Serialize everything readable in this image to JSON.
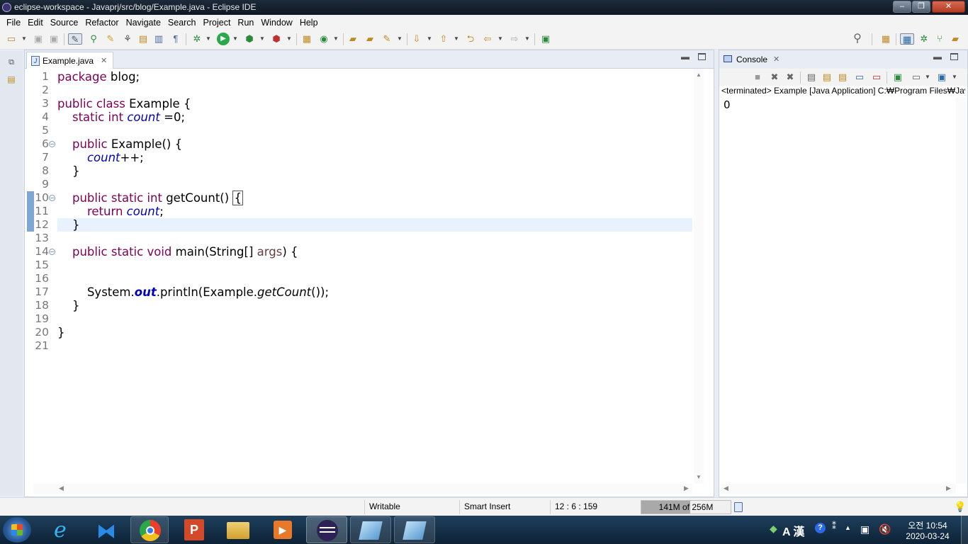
{
  "window": {
    "title": "eclipse-workspace - Javaprj/src/blog/Example.java - Eclipse IDE"
  },
  "menu": [
    "File",
    "Edit",
    "Source",
    "Refactor",
    "Navigate",
    "Search",
    "Project",
    "Run",
    "Window",
    "Help"
  ],
  "editor": {
    "tab": "Example.java",
    "lines": [
      {
        "n": "1",
        "segs": [
          {
            "t": "package",
            "c": "kw"
          },
          {
            "t": " blog;"
          }
        ]
      },
      {
        "n": "2",
        "segs": []
      },
      {
        "n": "3",
        "segs": [
          {
            "t": "public",
            "c": "kw"
          },
          {
            "t": " "
          },
          {
            "t": "class",
            "c": "kw"
          },
          {
            "t": " Example {"
          }
        ]
      },
      {
        "n": "4",
        "segs": [
          {
            "t": "    "
          },
          {
            "t": "static",
            "c": "kw"
          },
          {
            "t": " "
          },
          {
            "t": "int",
            "c": "kw"
          },
          {
            "t": " "
          },
          {
            "t": "count",
            "c": "fld"
          },
          {
            "t": " =0;"
          }
        ]
      },
      {
        "n": "5",
        "segs": []
      },
      {
        "n": "6",
        "fold": true,
        "segs": [
          {
            "t": "    "
          },
          {
            "t": "public",
            "c": "kw"
          },
          {
            "t": " Example() {"
          }
        ]
      },
      {
        "n": "7",
        "segs": [
          {
            "t": "        "
          },
          {
            "t": "count",
            "c": "fld"
          },
          {
            "t": "++;"
          }
        ]
      },
      {
        "n": "8",
        "segs": [
          {
            "t": "    }"
          }
        ]
      },
      {
        "n": "9",
        "segs": []
      },
      {
        "n": "10",
        "fold": true,
        "mark": true,
        "segs": [
          {
            "t": "    "
          },
          {
            "t": "public",
            "c": "kw"
          },
          {
            "t": " "
          },
          {
            "t": "static",
            "c": "kw"
          },
          {
            "t": " "
          },
          {
            "t": "int",
            "c": "kw"
          },
          {
            "t": " getCount() "
          },
          {
            "t": "{",
            "c": "brace"
          }
        ]
      },
      {
        "n": "11",
        "mark": true,
        "segs": [
          {
            "t": "        "
          },
          {
            "t": "return",
            "c": "kw"
          },
          {
            "t": " "
          },
          {
            "t": "count",
            "c": "fld"
          },
          {
            "t": ";"
          }
        ]
      },
      {
        "n": "12",
        "mark": true,
        "current": true,
        "segs": [
          {
            "t": "    }"
          }
        ]
      },
      {
        "n": "13",
        "segs": []
      },
      {
        "n": "14",
        "fold": true,
        "segs": [
          {
            "t": "    "
          },
          {
            "t": "public",
            "c": "kw"
          },
          {
            "t": " "
          },
          {
            "t": "static",
            "c": "kw"
          },
          {
            "t": " "
          },
          {
            "t": "void",
            "c": "kw"
          },
          {
            "t": " main(String[] "
          },
          {
            "t": "args",
            "c": "prm"
          },
          {
            "t": ") {"
          }
        ]
      },
      {
        "n": "15",
        "segs": []
      },
      {
        "n": "16",
        "segs": []
      },
      {
        "n": "17",
        "segs": [
          {
            "t": "        System."
          },
          {
            "t": "out",
            "c": "sfld"
          },
          {
            "t": ".println(Example."
          },
          {
            "t": "getCount",
            "c": "mth"
          },
          {
            "t": "());"
          }
        ]
      },
      {
        "n": "18",
        "segs": [
          {
            "t": "    }"
          }
        ]
      },
      {
        "n": "19",
        "segs": []
      },
      {
        "n": "20",
        "segs": [
          {
            "t": "}"
          }
        ]
      },
      {
        "n": "21",
        "segs": []
      }
    ]
  },
  "console": {
    "tab": "Console",
    "header": "<terminated> Example [Java Application] C:₩Program Files₩Jav",
    "output": "0"
  },
  "status": {
    "writable": "Writable",
    "insert": "Smart Insert",
    "position": "12 : 6 : 159",
    "heap": "141M of 256M",
    "heap_fraction": 0.55
  },
  "clock": {
    "time": "오전 10:54",
    "date": "2020-03-24"
  },
  "tray": {
    "ime": "A 漢"
  }
}
